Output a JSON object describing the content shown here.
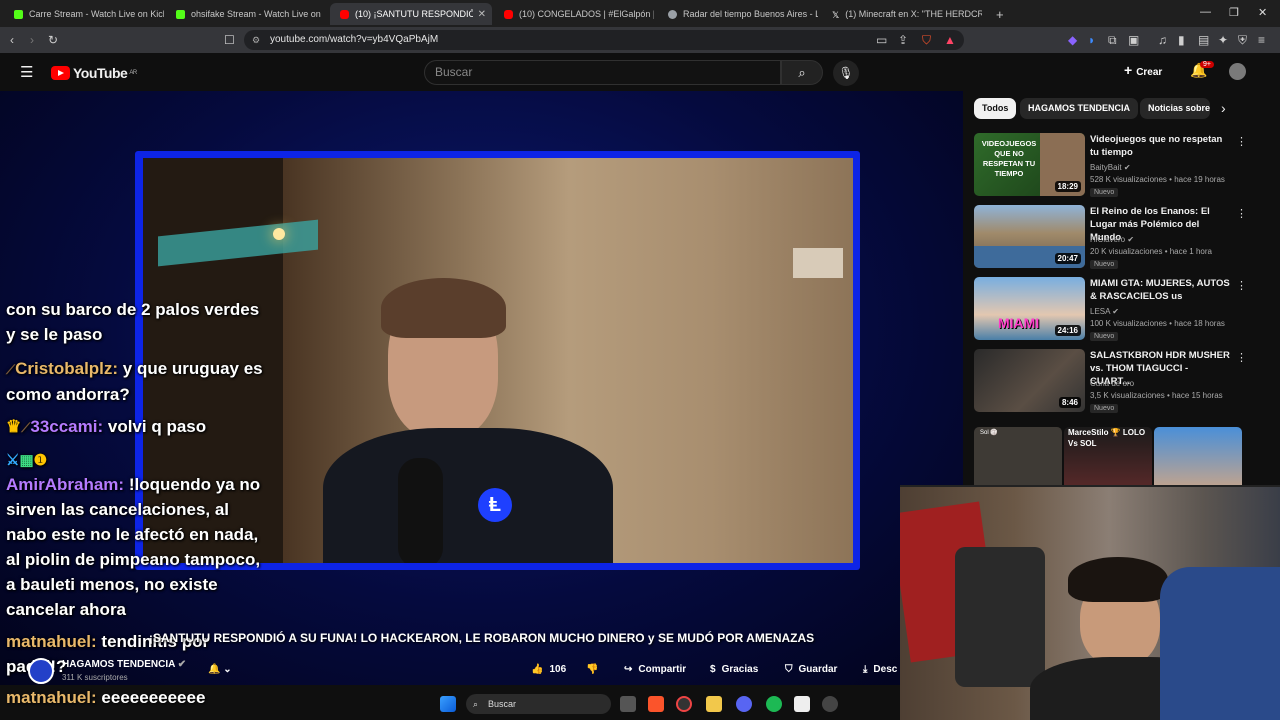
{
  "browser": {
    "tabs": [
      {
        "label": "Carre Stream - Watch Live on Kick",
        "color": "#53fc18"
      },
      {
        "label": "ohsifake Stream - Watch Live on",
        "color": "#53fc18"
      },
      {
        "label": "(10) ¡SANTUTU RESPONDIÓ A SU",
        "color": "#ff0000"
      },
      {
        "label": "(10) CONGELADOS | #ElGalpón | CO",
        "color": "#ff0000"
      },
      {
        "label": "Radar del tiempo Buenos Aires - Llu",
        "color": "#9aa0a6"
      },
      {
        "label": "(1) Minecraft en X: \"THE HERDCRAFT",
        "color": "#ffffff"
      }
    ],
    "new_tab": "+",
    "url": "youtube.com/watch?v=yb4VQaPbAjM"
  },
  "youtube": {
    "logo_text": "YouTube",
    "logo_region": "AR",
    "search_placeholder": "Buscar",
    "create_label": "Crear",
    "notification_count": "9+"
  },
  "video": {
    "title": "¡SANTUTU RESPONDIÓ A SU FUNA! LO HACKEARON, LE ROBARON MUCHO DINERO y SE MUDÓ POR AMENAZAS",
    "channel_name": "HAGAMOS TENDENCIA",
    "subscribers": "311 K suscriptores",
    "likes": "106",
    "share_label": "Compartir",
    "thanks_label": "Gracias",
    "save_label": "Guardar",
    "download_label": "Desc"
  },
  "chat_overlay": [
    {
      "user": "",
      "text": "con su barco de 2 palos verdes y se le paso",
      "user_color": "#ffffff"
    },
    {
      "user": "Cristobalplz:",
      "text": "y que uruguay es como andorra?",
      "user_color": "#e8b86a"
    },
    {
      "user": "33ccami:",
      "text": "volvi q paso",
      "user_color": "#b57bff"
    },
    {
      "user": "AmirAbraham:",
      "text": "!loquendo ya no sirven las cancelaciones, al nabo este no le afectó en nada, al piolin de pimpeano tampoco, a bauleti menos, no existe cancelar ahora",
      "user_color": "#b57bff"
    },
    {
      "user": "matnahuel:",
      "text": "tendinitis por padel!?",
      "user_color": "#e8b86a"
    },
    {
      "user": "matnahuel:",
      "text": "eeeeeeeeeee",
      "user_color": "#e8b86a"
    }
  ],
  "sidebar": {
    "chips": [
      "Todos",
      "HAGAMOS TENDENCIA",
      "Noticias sobre"
    ],
    "recommendations": [
      {
        "title": "Videojuegos que no respetan tu tiempo",
        "channel": "BaityBait",
        "views": "528 K visualizaciones",
        "age": "hace 19 horas",
        "badge": "Nuevo",
        "duration": "18:29",
        "thumb_text": "VIDEOJUEGOS QUE NO RESPETAN TU TIEMPO",
        "thumb_color": "#2f6b2a"
      },
      {
        "title": "El Reino de los Enanos: El Lugar más Polémico del Mundo",
        "channel": "HiClavero",
        "views": "20 K visualizaciones",
        "age": "hace 1 hora",
        "badge": "Nuevo",
        "duration": "20:47",
        "thumb_text": "",
        "thumb_color": "#6a5a4a"
      },
      {
        "title": "MIAMI GTA: MUJERES, AUTOS & RASCACIELOS us",
        "channel": "LESA",
        "views": "100 K visualizaciones",
        "age": "hace 18 horas",
        "badge": "Nuevo",
        "duration": "24:16",
        "thumb_text": "MIAMI",
        "thumb_color": "#4a7fa8"
      },
      {
        "title": "SALASTKBRON HDR MUSHER vs. THOM TIAGUCCI - CUART...",
        "channel": "Cuna de oro",
        "views": "3,5 K visualizaciones",
        "age": "hace 15 horas",
        "badge": "Nuevo",
        "duration": "8:46",
        "thumb_text": "",
        "thumb_color": "#3a3a3a"
      }
    ],
    "shorts": [
      {
        "label": "Sol 🏐",
        "color": "#3e3a35"
      },
      {
        "label": "MarceStilo 🏆 LOLO Vs SOL",
        "color": "#5a2a2a"
      },
      {
        "label": "",
        "color": "#4a6fa8"
      }
    ]
  },
  "taskbar": {
    "search_label": "Buscar"
  }
}
